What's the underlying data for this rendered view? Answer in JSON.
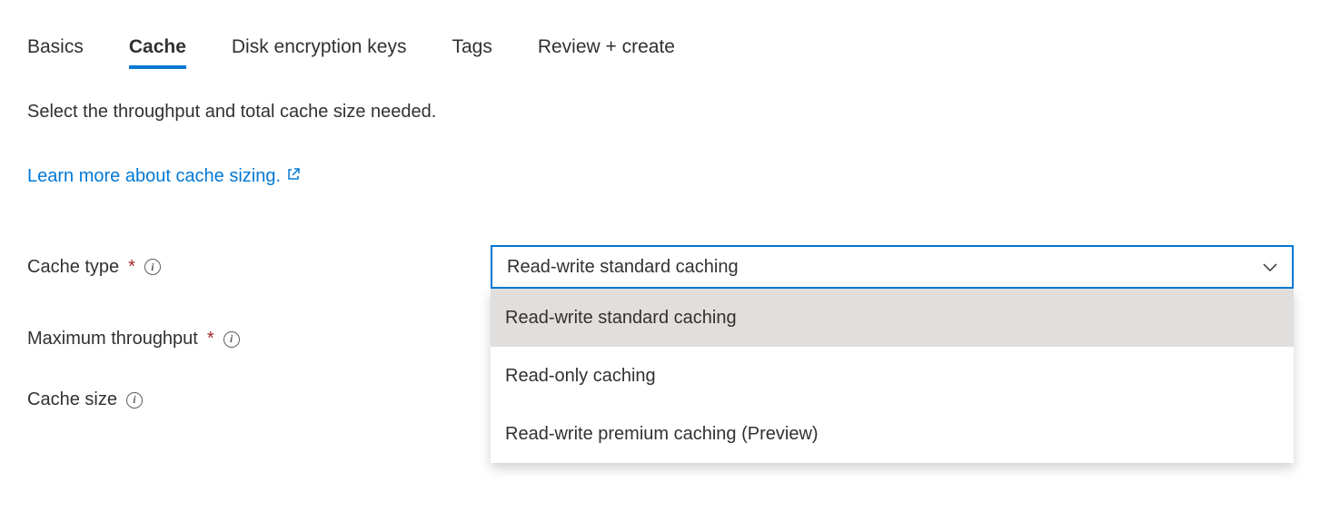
{
  "tabs": {
    "items": [
      {
        "label": "Basics",
        "active": false
      },
      {
        "label": "Cache",
        "active": true
      },
      {
        "label": "Disk encryption keys",
        "active": false
      },
      {
        "label": "Tags",
        "active": false
      },
      {
        "label": "Review + create",
        "active": false
      }
    ]
  },
  "description": "Select the throughput and total cache size needed.",
  "learn_more": "Learn more about cache sizing.",
  "form": {
    "cache_type": {
      "label": "Cache type",
      "required": true,
      "value": "Read-write standard caching",
      "options": [
        "Read-write standard caching",
        "Read-only caching",
        "Read-write premium caching (Preview)"
      ]
    },
    "max_throughput": {
      "label": "Maximum throughput",
      "required": true
    },
    "cache_size": {
      "label": "Cache size",
      "required": false
    }
  }
}
